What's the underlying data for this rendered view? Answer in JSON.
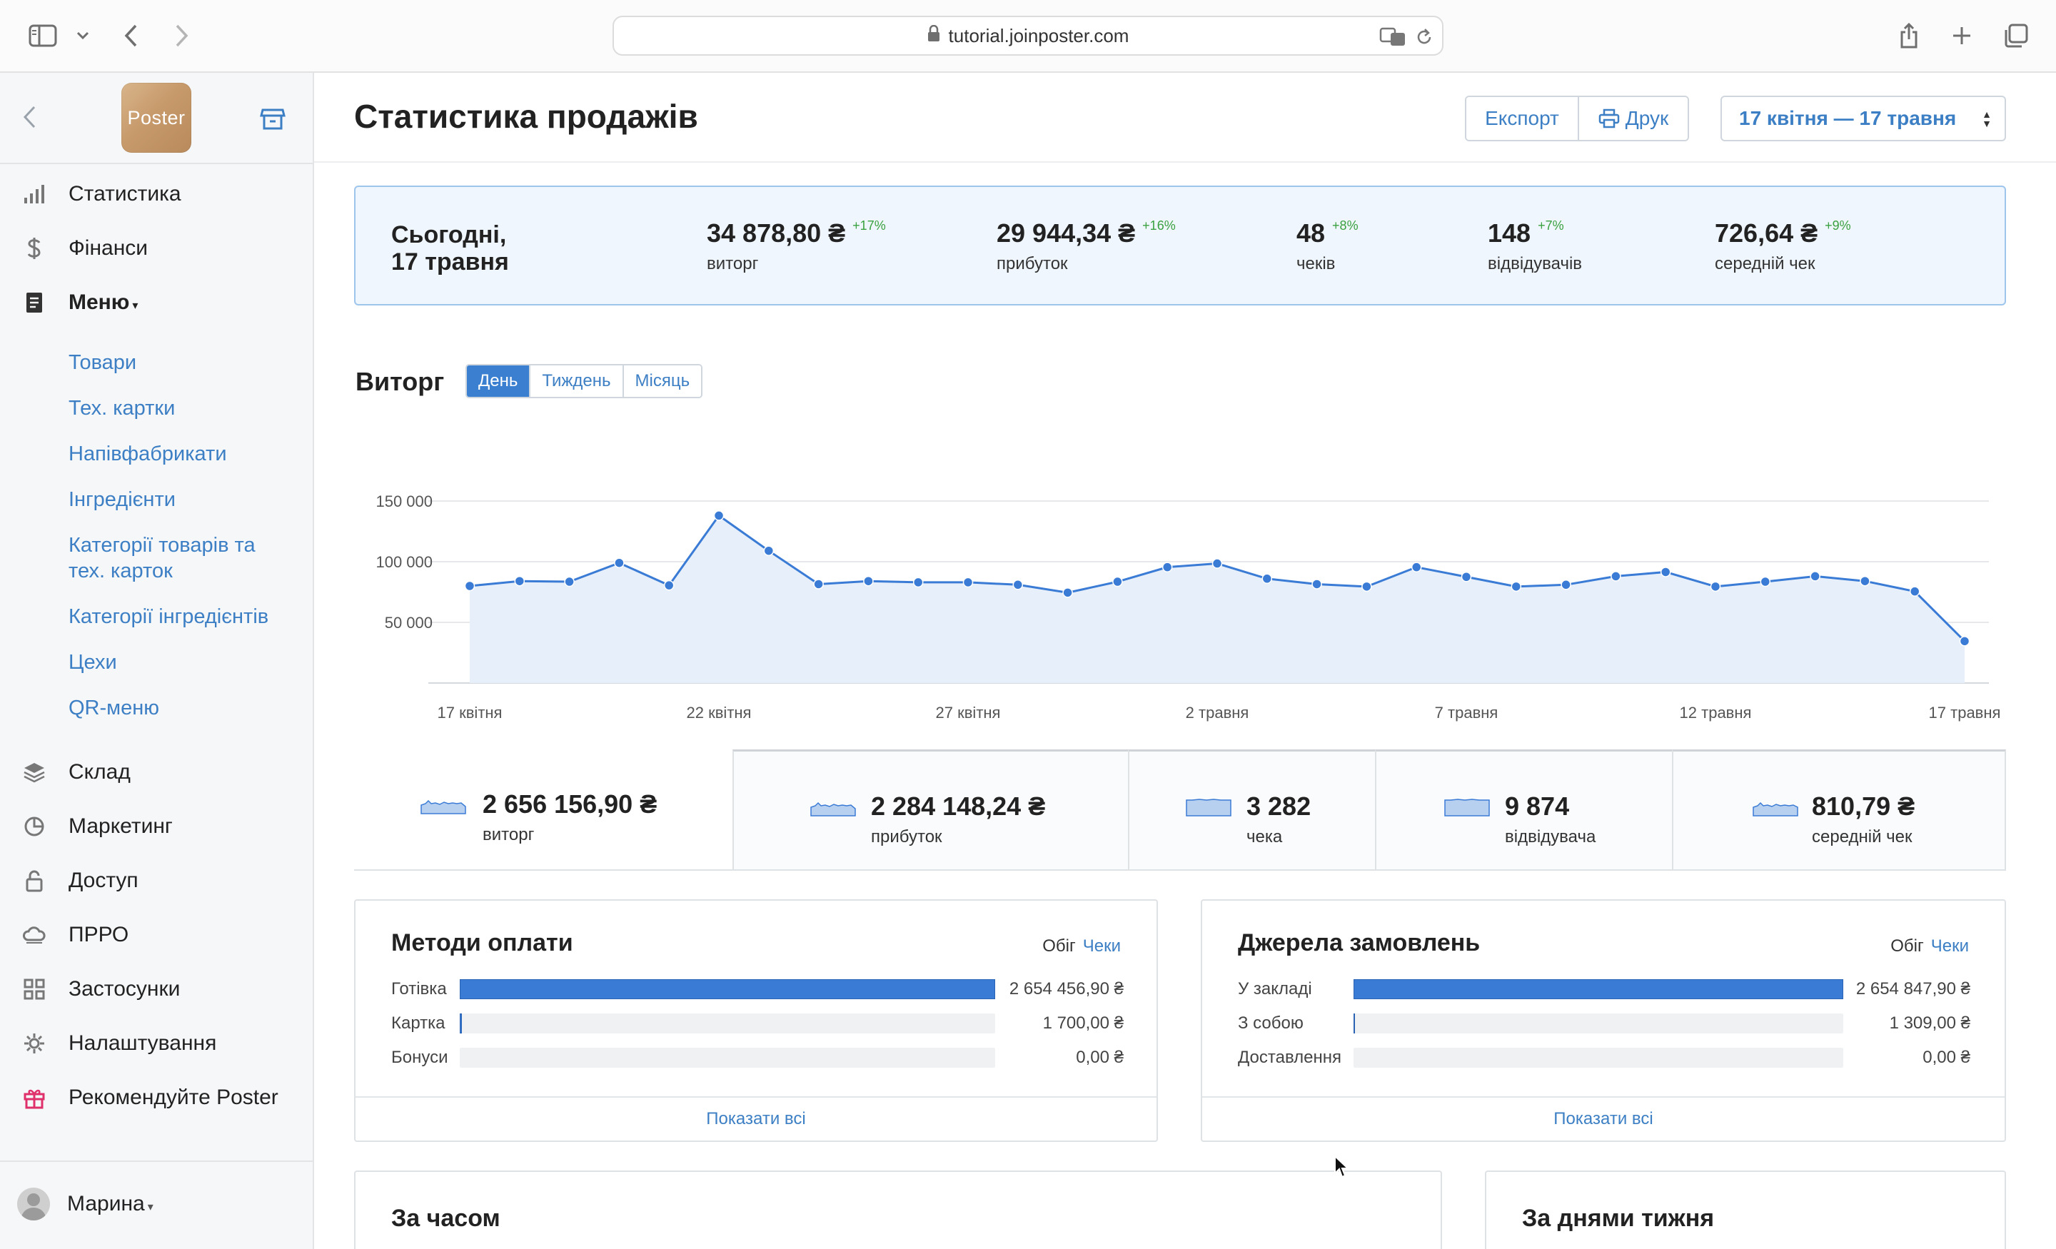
{
  "browser": {
    "url": "tutorial.joinposter.com"
  },
  "sidebar": {
    "logo_text": "Poster",
    "items": [
      {
        "label": "Статистика",
        "icon": "bar-chart-icon"
      },
      {
        "label": "Фінанси",
        "icon": "dollar-icon"
      },
      {
        "label": "Меню",
        "icon": "document-icon",
        "caret": "▾"
      },
      {
        "label": "Склад",
        "icon": "layers-icon"
      },
      {
        "label": "Маркетинг",
        "icon": "pie-icon"
      },
      {
        "label": "Доступ",
        "icon": "lock-icon"
      },
      {
        "label": "ПРРО",
        "icon": "cloud-icon"
      },
      {
        "label": "Застосунки",
        "icon": "grid-icon"
      },
      {
        "label": "Налаштування",
        "icon": "gear-icon"
      },
      {
        "label": "Рекомендуйте Poster",
        "icon": "gift-icon"
      }
    ],
    "submenu": [
      "Товари",
      "Тех. картки",
      "Напівфабрикати",
      "Інгредієнти",
      "Категорії товарів та тех. карток",
      "Категорії інгредієнтів",
      "Цехи",
      "QR-меню"
    ],
    "user_name": "Марина",
    "user_caret": "▾"
  },
  "header": {
    "title": "Статистика продажів",
    "export_label": "Експорт",
    "print_label": "Друк",
    "date_range": "17 квітня — 17 травня"
  },
  "today": {
    "label_line1": "Сьогодні,",
    "label_line2": "17 травня",
    "stats": [
      {
        "value": "34 878,80 ₴",
        "pct": "+17%",
        "label": "виторг"
      },
      {
        "value": "29 944,34 ₴",
        "pct": "+16%",
        "label": "прибуток"
      },
      {
        "value": "48",
        "pct": "+8%",
        "label": "чеків"
      },
      {
        "value": "148",
        "pct": "+7%",
        "label": "відвідувачів"
      },
      {
        "value": "726,64 ₴",
        "pct": "+9%",
        "label": "середній чек"
      }
    ]
  },
  "revenue": {
    "title": "Виторг",
    "tabs": [
      "День",
      "Тиждень",
      "Місяць"
    ],
    "active_tab": 0
  },
  "chart_data": {
    "type": "area",
    "x_tick_labels": [
      "17 квітня",
      "22 квітня",
      "27 квітня",
      "2 травня",
      "7 травня",
      "12 травня",
      "17 травня"
    ],
    "y_tick_labels": [
      "50 000",
      "100 000",
      "150 000"
    ],
    "ylim": [
      0,
      150000
    ],
    "grid": true,
    "color": "#3a7bd5",
    "fill": "#e6effa",
    "series": [
      {
        "values": [
          80000,
          84000,
          83500,
          99000,
          80500,
          138000,
          109000,
          81500,
          84000,
          83000,
          83000,
          81000,
          74500,
          83500,
          95500,
          98500,
          86000,
          81500,
          79500,
          95500,
          87500,
          79500,
          81000,
          88000,
          91500,
          79500,
          83500,
          88000,
          84000,
          75500,
          34500
        ]
      }
    ]
  },
  "totals": [
    {
      "value": "2 656 156,90 ₴",
      "label": "виторг"
    },
    {
      "value": "2 284 148,24 ₴",
      "label": "прибуток"
    },
    {
      "value": "3 282",
      "label": "чека"
    },
    {
      "value": "9 874",
      "label": "відвідувача"
    },
    {
      "value": "810,79 ₴",
      "label": "середній чек"
    }
  ],
  "payment_methods": {
    "title": "Методи оплати",
    "toggle": [
      "Обіг",
      "Чеки"
    ],
    "rows": [
      {
        "label": "Готівка",
        "value": "2 654 456,90 ₴",
        "share": 0.9994
      },
      {
        "label": "Картка",
        "value": "1 700,00 ₴",
        "share": 0.004
      },
      {
        "label": "Бонуси",
        "value": "0,00 ₴",
        "share": 0
      }
    ],
    "footer": "Показати всі"
  },
  "order_sources": {
    "title": "Джерела замовлень",
    "toggle": [
      "Обіг",
      "Чеки"
    ],
    "rows": [
      {
        "label": "У закладі",
        "value": "2 654 847,90 ₴",
        "share": 0.9995
      },
      {
        "label": "З собою",
        "value": "1 309,00 ₴",
        "share": 0.003
      },
      {
        "label": "Доставлення",
        "value": "0,00 ₴",
        "share": 0
      }
    ],
    "footer": "Показати всі"
  },
  "by_time": {
    "title": "За часом"
  },
  "by_weekday": {
    "title": "За днями тижня"
  }
}
